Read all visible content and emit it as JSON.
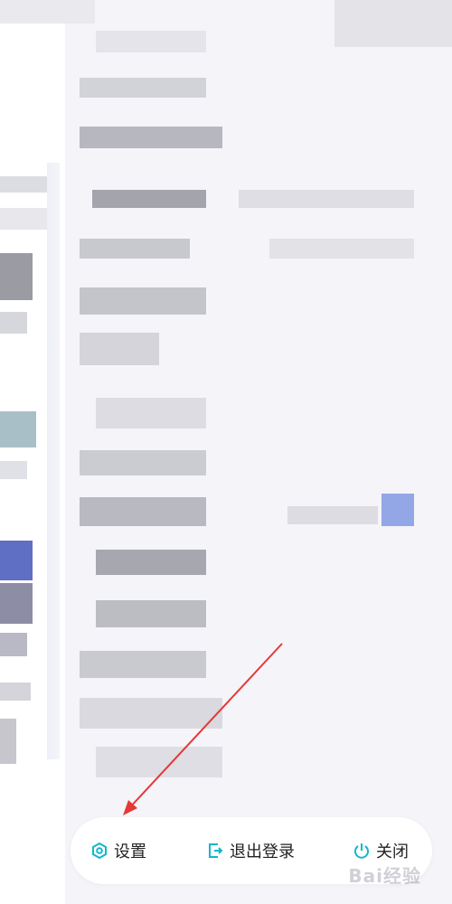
{
  "bottom_bar": {
    "settings": {
      "label": "设置",
      "icon": "settings-icon"
    },
    "logout": {
      "label": "退出登录",
      "icon": "logout-icon"
    },
    "close": {
      "label": "关闭",
      "icon": "power-icon"
    }
  },
  "watermark": {
    "text": "Bai经验"
  },
  "colors": {
    "accent": "#12b7c9",
    "arrow": "#e53935",
    "background": "#f4f4f9"
  }
}
